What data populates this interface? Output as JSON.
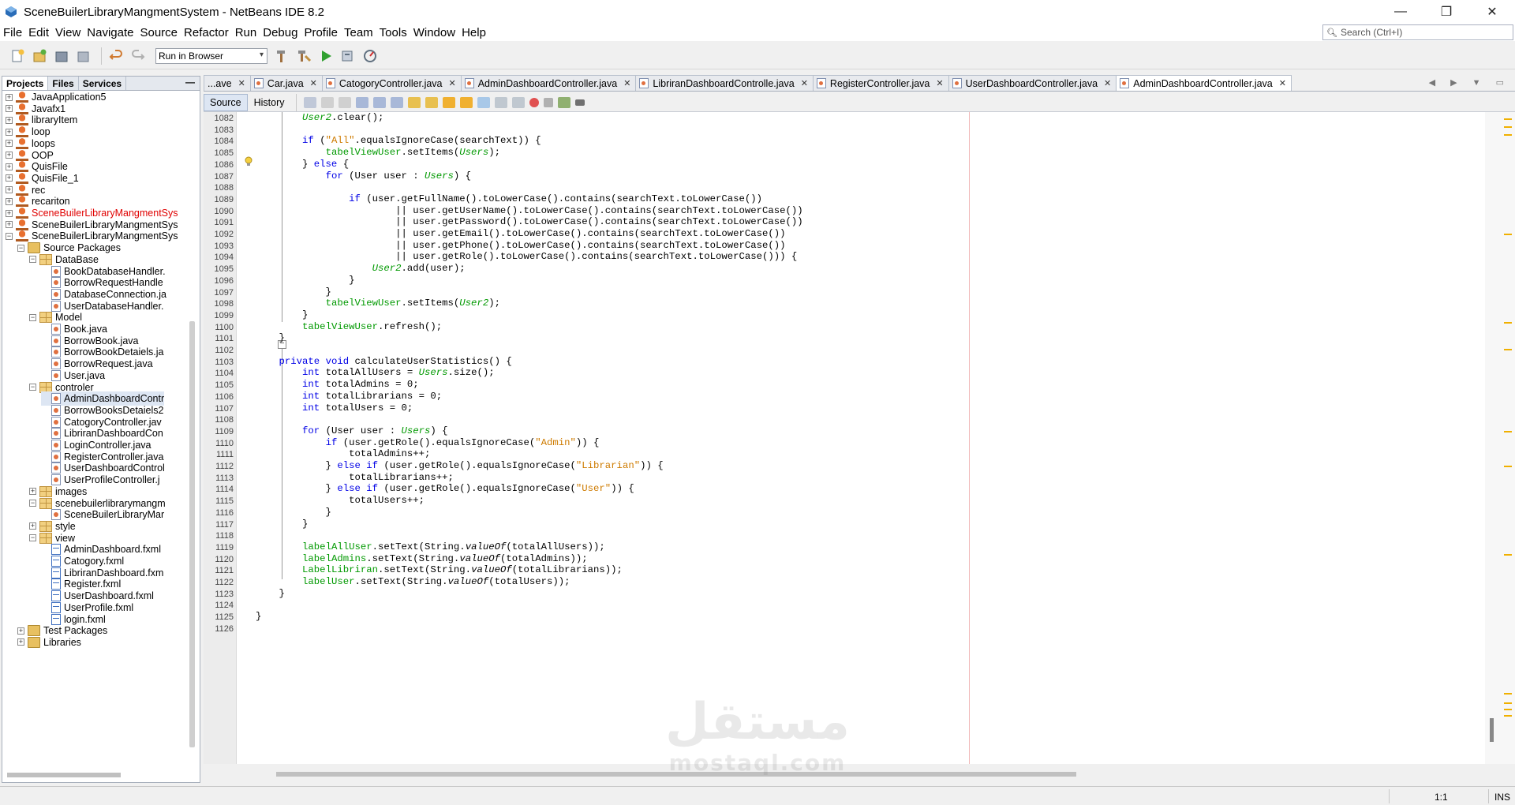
{
  "window": {
    "title": "SceneBuilerLibraryMangmentSystem - NetBeans IDE 8.2",
    "minimize": "—",
    "restore": "❐",
    "close": "✕"
  },
  "menu": [
    "File",
    "Edit",
    "View",
    "Navigate",
    "Source",
    "Refactor",
    "Run",
    "Debug",
    "Profile",
    "Team",
    "Tools",
    "Window",
    "Help"
  ],
  "search": {
    "placeholder": "Search (Ctrl+I)"
  },
  "toolbar": {
    "run_config": "Run in Browser"
  },
  "left_panel": {
    "tabs": [
      "Projects",
      "Files",
      "Services"
    ],
    "minimize": "—",
    "tree": [
      {
        "label": "JavaApplication5",
        "icon": "project-icon"
      },
      {
        "label": "Javafx1",
        "icon": "project-icon"
      },
      {
        "label": "libraryItem",
        "icon": "project-icon"
      },
      {
        "label": "loop",
        "icon": "project-icon"
      },
      {
        "label": "loops",
        "icon": "project-icon"
      },
      {
        "label": "OOP",
        "icon": "project-icon"
      },
      {
        "label": "QuisFile",
        "icon": "project-icon"
      },
      {
        "label": "QuisFile_1",
        "icon": "project-icon"
      },
      {
        "label": "rec",
        "icon": "project-icon"
      },
      {
        "label": "recariton",
        "icon": "project-icon"
      },
      {
        "label": "SceneBuilerLibraryMangmentSys",
        "icon": "project-icon"
      },
      {
        "label": "SceneBuilerLibraryMangmentSys",
        "icon": "project-icon"
      },
      {
        "label": "SceneBuilerLibraryMangmentSys",
        "icon": "project-icon"
      },
      {
        "label": "Source Packages",
        "icon": "folder-icon"
      },
      {
        "label": "DataBase",
        "icon": "package-icon"
      },
      {
        "label": "BookDatabaseHandler.",
        "icon": "java-file-icon"
      },
      {
        "label": "BorrowRequestHandle",
        "icon": "java-file-icon"
      },
      {
        "label": "DatabaseConnection.ja",
        "icon": "java-file-icon"
      },
      {
        "label": "UserDatabaseHandler.",
        "icon": "java-file-icon"
      },
      {
        "label": "Model",
        "icon": "package-icon"
      },
      {
        "label": "Book.java",
        "icon": "java-file-icon"
      },
      {
        "label": "BorrowBook.java",
        "icon": "java-file-icon"
      },
      {
        "label": "BorrowBookDetaiels.ja",
        "icon": "java-file-icon"
      },
      {
        "label": "BorrowRequest.java",
        "icon": "java-file-icon"
      },
      {
        "label": "User.java",
        "icon": "java-file-icon"
      },
      {
        "label": "controler",
        "icon": "package-icon"
      },
      {
        "label": "AdminDashboardContr",
        "icon": "java-file-icon"
      },
      {
        "label": "BorrowBooksDetaiels2",
        "icon": "java-file-icon"
      },
      {
        "label": "CatogoryController.jav",
        "icon": "java-file-icon"
      },
      {
        "label": "LibriranDashboardCon",
        "icon": "java-file-icon"
      },
      {
        "label": "LoginController.java",
        "icon": "java-file-icon"
      },
      {
        "label": "RegisterController.java",
        "icon": "java-file-icon"
      },
      {
        "label": "UserDashboardControl",
        "icon": "java-file-icon"
      },
      {
        "label": "UserProfileController.j",
        "icon": "java-file-icon"
      },
      {
        "label": "images",
        "icon": "package-icon"
      },
      {
        "label": "scenebuilerlibrarymangm",
        "icon": "package-icon"
      },
      {
        "label": "SceneBuilerLibraryMar",
        "icon": "java-file-icon"
      },
      {
        "label": "style",
        "icon": "package-icon"
      },
      {
        "label": "view",
        "icon": "package-icon"
      },
      {
        "label": "AdminDashboard.fxml",
        "icon": "fxml-file-icon"
      },
      {
        "label": "Catogory.fxml",
        "icon": "fxml-file-icon"
      },
      {
        "label": "LibriranDashboard.fxm",
        "icon": "fxml-file-icon"
      },
      {
        "label": "Register.fxml",
        "icon": "fxml-file-icon"
      },
      {
        "label": "UserDashboard.fxml",
        "icon": "fxml-file-icon"
      },
      {
        "label": "UserProfile.fxml",
        "icon": "fxml-file-icon"
      },
      {
        "label": "login.fxml",
        "icon": "fxml-file-icon"
      },
      {
        "label": "Test Packages",
        "icon": "folder-icon"
      },
      {
        "label": "Libraries",
        "icon": "folder-icon"
      }
    ]
  },
  "editor_tabs": [
    {
      "label": "...ave",
      "x": "✕"
    },
    {
      "label": "Car.java",
      "x": "✕"
    },
    {
      "label": "CatogoryController.java",
      "x": "✕"
    },
    {
      "label": "AdminDashboardController.java",
      "x": "✕"
    },
    {
      "label": "LibriranDashboardControlle.java",
      "x": "✕"
    },
    {
      "label": "RegisterController.java",
      "x": "✕"
    },
    {
      "label": "UserDashboardController.java",
      "x": "✕"
    },
    {
      "label": "AdminDashboardController.java",
      "x": "✕"
    }
  ],
  "editor_tab_nav": "◀ ▶ ▼ ▭",
  "source_tabs": {
    "source": "Source",
    "history": "History"
  },
  "code_lines": [
    {
      "n": "1082",
      "t": "        User2.clear();"
    },
    {
      "n": "1083",
      "t": ""
    },
    {
      "n": "1084",
      "t": "        if (\"All\".equalsIgnoreCase(searchText)) {"
    },
    {
      "n": "1085",
      "t": "            tabelViewUser.setItems(Users);"
    },
    {
      "n": "1086",
      "t": "        } else {"
    },
    {
      "n": "1087",
      "t": "            for (User user : Users) {"
    },
    {
      "n": "1088",
      "t": ""
    },
    {
      "n": "1089",
      "t": "                if (user.getFullName().toLowerCase().contains(searchText.toLowerCase())"
    },
    {
      "n": "1090",
      "t": "                        || user.getUserName().toLowerCase().contains(searchText.toLowerCase())"
    },
    {
      "n": "1091",
      "t": "                        || user.getPassword().toLowerCase().contains(searchText.toLowerCase())"
    },
    {
      "n": "1092",
      "t": "                        || user.getEmail().toLowerCase().contains(searchText.toLowerCase())"
    },
    {
      "n": "1093",
      "t": "                        || user.getPhone().toLowerCase().contains(searchText.toLowerCase())"
    },
    {
      "n": "1094",
      "t": "                        || user.getRole().toLowerCase().contains(searchText.toLowerCase())) {"
    },
    {
      "n": "1095",
      "t": "                    User2.add(user);"
    },
    {
      "n": "1096",
      "t": "                }"
    },
    {
      "n": "1097",
      "t": "            }"
    },
    {
      "n": "1098",
      "t": "            tabelViewUser.setItems(User2);"
    },
    {
      "n": "1099",
      "t": "        }"
    },
    {
      "n": "1100",
      "t": "        tabelViewUser.refresh();"
    },
    {
      "n": "1101",
      "t": "    }"
    },
    {
      "n": "1102",
      "t": ""
    },
    {
      "n": "1103",
      "t": "    private void calculateUserStatistics() {"
    },
    {
      "n": "1104",
      "t": "        int totalAllUsers = Users.size();"
    },
    {
      "n": "1105",
      "t": "        int totalAdmins = 0;"
    },
    {
      "n": "1106",
      "t": "        int totalLibrarians = 0;"
    },
    {
      "n": "1107",
      "t": "        int totalUsers = 0;"
    },
    {
      "n": "1108",
      "t": ""
    },
    {
      "n": "1109",
      "t": "        for (User user : Users) {"
    },
    {
      "n": "1110",
      "t": "            if (user.getRole().equalsIgnoreCase(\"Admin\")) {"
    },
    {
      "n": "1111",
      "t": "                totalAdmins++;"
    },
    {
      "n": "1112",
      "t": "            } else if (user.getRole().equalsIgnoreCase(\"Librarian\")) {"
    },
    {
      "n": "1113",
      "t": "                totalLibrarians++;"
    },
    {
      "n": "1114",
      "t": "            } else if (user.getRole().equalsIgnoreCase(\"User\")) {"
    },
    {
      "n": "1115",
      "t": "                totalUsers++;"
    },
    {
      "n": "1116",
      "t": "            }"
    },
    {
      "n": "1117",
      "t": "        }"
    },
    {
      "n": "1118",
      "t": ""
    },
    {
      "n": "1119",
      "t": "        labelAllUser.setText(String.valueOf(totalAllUsers));"
    },
    {
      "n": "1120",
      "t": "        labelAdmins.setText(String.valueOf(totalAdmins));"
    },
    {
      "n": "1121",
      "t": "        LabelLibriran.setText(String.valueOf(totalLibrarians));"
    },
    {
      "n": "1122",
      "t": "        labelUser.setText(String.valueOf(totalUsers));"
    },
    {
      "n": "1123",
      "t": "    }"
    },
    {
      "n": "1124",
      "t": ""
    },
    {
      "n": "1125",
      "t": "}"
    },
    {
      "n": "1126",
      "t": ""
    }
  ],
  "watermark": {
    "arabic": "مستقل",
    "latin": "mostaql.com"
  },
  "status": {
    "position": "1:1",
    "mode": "INS"
  },
  "colors": {
    "keyword": "#0000e6",
    "field": "#009900",
    "string": "#ce7b00",
    "error_project": "#e00000"
  }
}
